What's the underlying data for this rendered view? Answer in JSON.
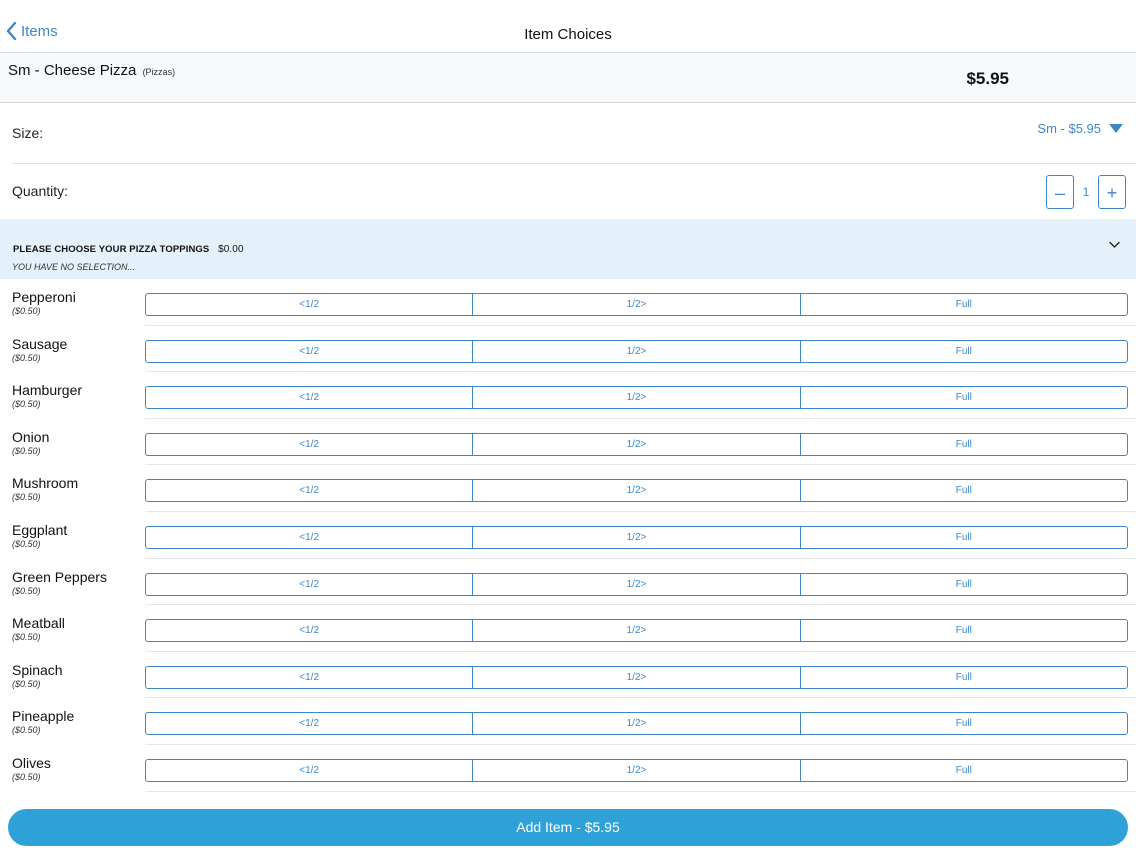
{
  "nav": {
    "back_label": "Items",
    "title": "Item Choices"
  },
  "item": {
    "name": "Sm - Cheese Pizza",
    "category": "(Pizzas)",
    "price": "$5.95"
  },
  "size": {
    "label": "Size:",
    "selected": "Sm - $5.95"
  },
  "quantity": {
    "label": "Quantity:",
    "minus": "–",
    "value": "1",
    "plus": "+"
  },
  "toppings_section": {
    "title": "PLEASE CHOOSE YOUR PIZZA TOPPINGS",
    "price": "$0.00",
    "subtitle": "YOU HAVE NO SELECTION..."
  },
  "options": {
    "left_half": "<1/2",
    "right_half": "1/2>",
    "full": "Full"
  },
  "toppings": [
    {
      "name": "Pepperoni",
      "price": "($0.50)"
    },
    {
      "name": "Sausage",
      "price": "($0.50)"
    },
    {
      "name": "Hamburger",
      "price": "($0.50)"
    },
    {
      "name": "Onion",
      "price": "($0.50)"
    },
    {
      "name": "Mushroom",
      "price": "($0.50)"
    },
    {
      "name": "Eggplant",
      "price": "($0.50)"
    },
    {
      "name": "Green Peppers",
      "price": "($0.50)"
    },
    {
      "name": "Meatball",
      "price": "($0.50)"
    },
    {
      "name": "Spinach",
      "price": "($0.50)"
    },
    {
      "name": "Pineapple",
      "price": "($0.50)"
    },
    {
      "name": "Olives",
      "price": "($0.50)"
    }
  ],
  "add_button": {
    "label": "Add Item - $5.95"
  },
  "colors": {
    "accent": "#3d87c9",
    "section_bg": "#e4f1fb",
    "add_button_bg": "#2ea2d8"
  }
}
